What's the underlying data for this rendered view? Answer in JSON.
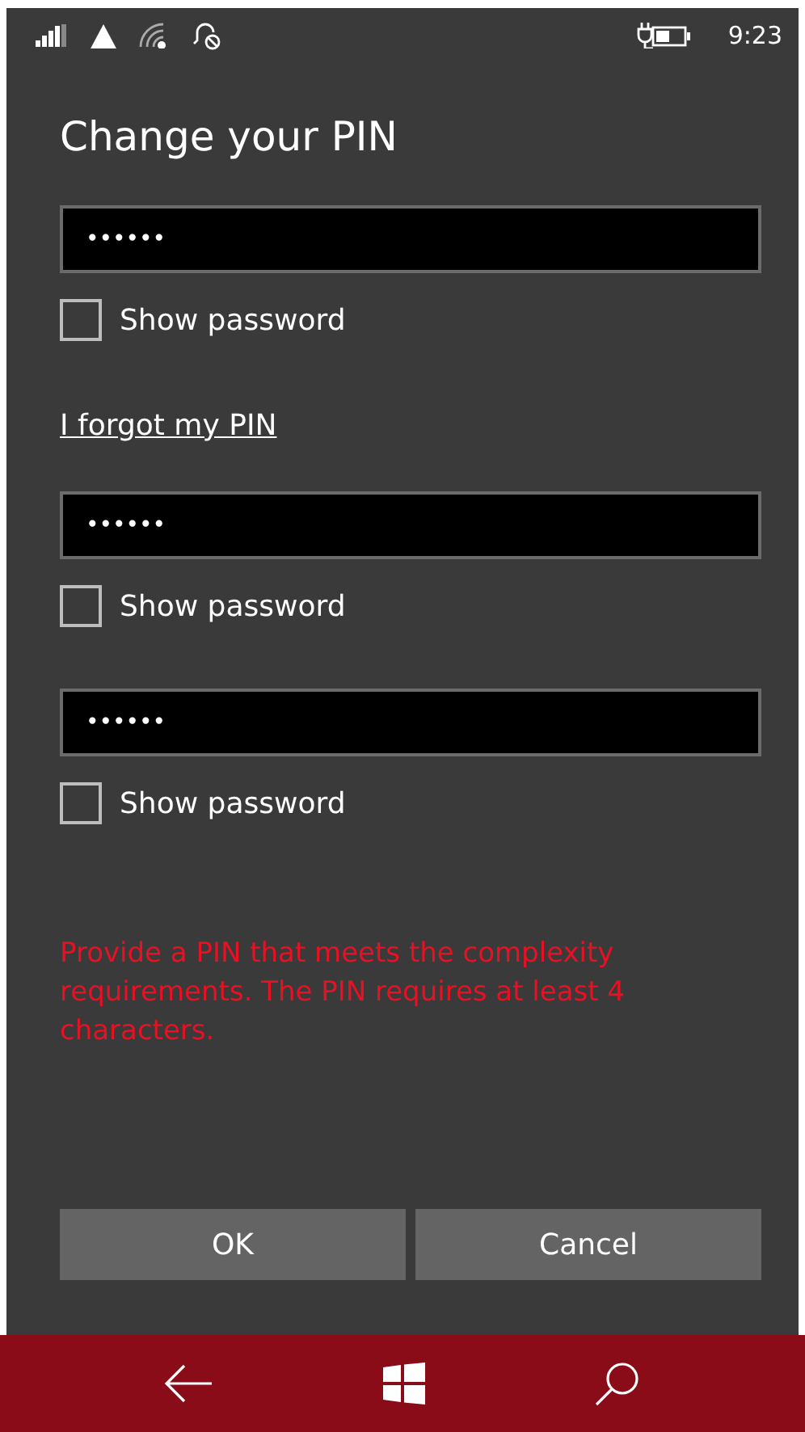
{
  "status_bar": {
    "time": "9:23"
  },
  "title": "Change your PIN",
  "form": [
    {
      "kind": "field",
      "value": "••••••",
      "show_password": {
        "label": "Show password",
        "checked": false
      }
    },
    {
      "kind": "link",
      "label": "I forgot my PIN"
    },
    {
      "kind": "field",
      "value": "••••••",
      "show_password": {
        "label": "Show password",
        "checked": false
      }
    },
    {
      "kind": "field",
      "value": "••••••",
      "show_password": {
        "label": "Show password",
        "checked": false
      }
    }
  ],
  "error": "Provide a PIN that meets the complexity requirements. The PIN requires at least 4 characters.",
  "buttons": [
    "OK",
    "Cancel"
  ]
}
